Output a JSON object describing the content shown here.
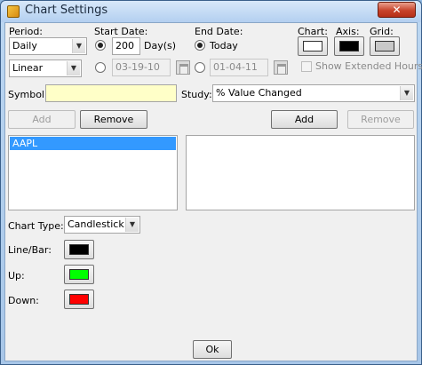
{
  "window": {
    "title": "Chart Settings",
    "close_glyph": "✕"
  },
  "period": {
    "label": "Period:",
    "value": "Daily",
    "scale_value": "Linear"
  },
  "start_date": {
    "label": "Start Date:",
    "days_value": "200",
    "days_unit": "Day(s)",
    "date_value": "03-19-10",
    "selected": "days"
  },
  "end_date": {
    "label": "End Date:",
    "today_label": "Today",
    "date_value": "01-04-11",
    "selected": "today"
  },
  "colors": {
    "chart_label": "Chart:",
    "axis_label": "Axis:",
    "grid_label": "Grid:",
    "chart_color": "#ffffff",
    "axis_color": "#000000",
    "grid_color": "#c8c8c8"
  },
  "show_extended_hours": {
    "label": "Show Extended Hours",
    "checked": false
  },
  "symbol": {
    "label": "Symbol:",
    "value": ""
  },
  "study": {
    "label": "Study:",
    "value": "% Value Changed"
  },
  "symbol_buttons": {
    "add": "Add",
    "remove": "Remove"
  },
  "study_buttons": {
    "add": "Add",
    "remove": "Remove"
  },
  "symbol_list": [
    "AAPL"
  ],
  "chart_type": {
    "label": "Chart Type:",
    "value": "Candlestick"
  },
  "line_bar": {
    "label": "Line/Bar:",
    "color": "#000000"
  },
  "up": {
    "label": "Up:",
    "color": "#00ff00"
  },
  "down": {
    "label": "Down:",
    "color": "#ff0000"
  },
  "ok_button": "Ok"
}
